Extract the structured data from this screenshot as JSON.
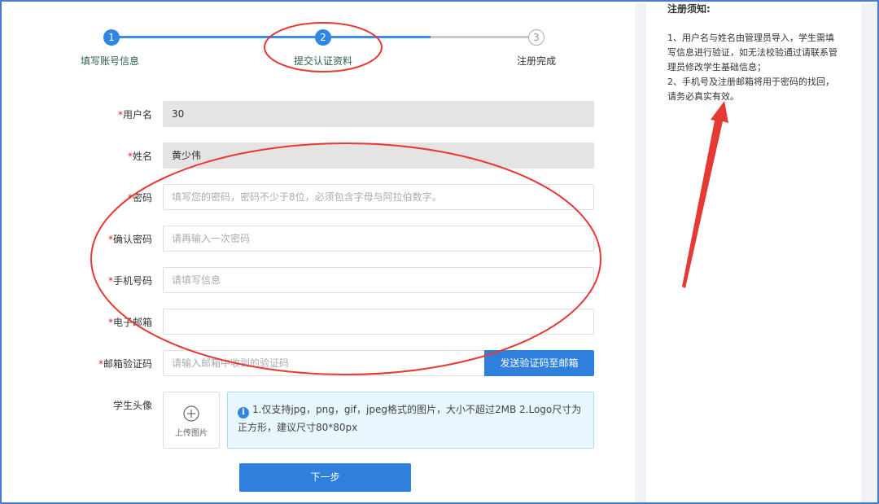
{
  "steps": [
    {
      "number": "1",
      "label": "填写账号信息"
    },
    {
      "number": "2",
      "label": "提交认证资料"
    },
    {
      "number": "3",
      "label": "注册完成"
    }
  ],
  "form": {
    "username": {
      "label": "用户名",
      "value": "30"
    },
    "name": {
      "label": "姓名",
      "value": "黄少伟"
    },
    "password": {
      "label": "密码",
      "placeholder": "填写您的密码，密码不少于8位，必须包含字母与阿拉伯数字。"
    },
    "confirm_password": {
      "label": "确认密码",
      "placeholder": "请再输入一次密码"
    },
    "phone": {
      "label": "手机号码",
      "placeholder": "请填写信息"
    },
    "email": {
      "label": "电子邮箱",
      "value": ""
    },
    "email_code": {
      "label": "邮箱验证码",
      "placeholder": "请输入邮箱中收到的验证码"
    },
    "send_code_button": "发送验证码至邮箱",
    "avatar": {
      "label": "学生头像",
      "upload_text": "上传图片"
    },
    "tip": "1.仅支持jpg，png，gif，jpeg格式的图片，大小不超过2MB 2.Logo尺寸为正方形，建议尺寸80*80px",
    "next_button": "下一步"
  },
  "notice": {
    "title": "注册须知:",
    "items": [
      "1、用户名与姓名由管理员导入，学生需填写信息进行验证，如无法校验通过请联系管理员修改学生基础信息；",
      "2、手机号及注册邮箱将用于密码的找回，请务必真实有效。"
    ]
  },
  "required_mark": "*",
  "colors": {
    "primary": "#2f7fdc",
    "annotation": "#e53935",
    "required": "#e02020"
  }
}
